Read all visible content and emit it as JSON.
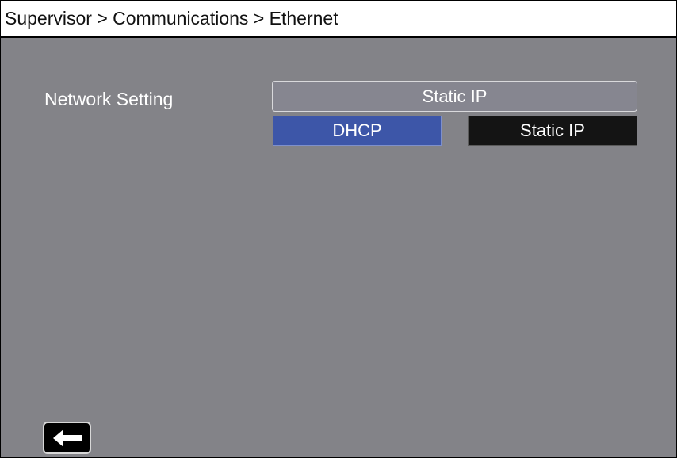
{
  "header": {
    "breadcrumb": "Supervisor > Communications > Ethernet"
  },
  "network_setting": {
    "label": "Network Setting",
    "current_value": "Static IP",
    "options": [
      {
        "label": "DHCP",
        "selected": true
      },
      {
        "label": "Static IP",
        "selected": false
      }
    ]
  },
  "footer": {
    "back_icon": "left-arrow-icon"
  },
  "colors": {
    "background": "#838388",
    "title_bar": "#ffffff",
    "selected_option": "#3d56a8",
    "unselected_option": "#141414"
  }
}
